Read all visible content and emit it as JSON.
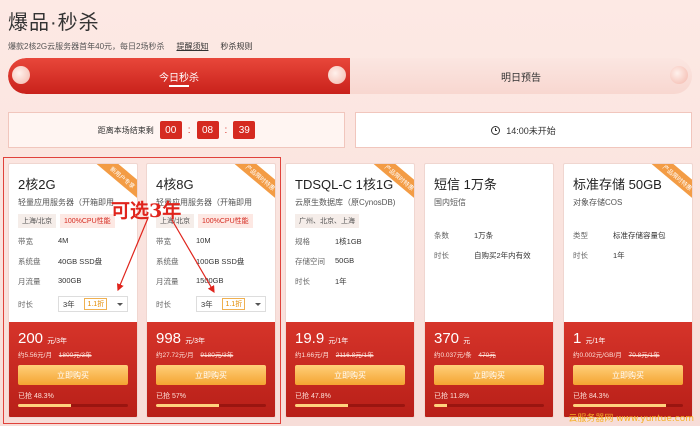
{
  "header": {
    "title": "爆品·秒杀",
    "description": "爆款2核2G云服务器首年40元，每日2场秒杀",
    "link_remind": "提醒须知",
    "link_rules": "秒杀规则"
  },
  "tabs": [
    {
      "label": "今日秒杀",
      "active": true
    },
    {
      "label": "明日预告",
      "active": false
    }
  ],
  "countdown": {
    "label": "距离本场结束剩",
    "hours": "00",
    "minutes": "08",
    "seconds": "39"
  },
  "next_session": {
    "label": "14:00未开始",
    "icon": "clock-icon"
  },
  "annotation": "可选3年",
  "watermark": "云服务器网 www.yuntue.com",
  "cards": [
    {
      "name": "2核2G",
      "desc": "轻量应用服务器（开箱即用",
      "tag_region": "上海/北京",
      "tag_perf": "100%CPU性能",
      "badge": "新用户专享",
      "specs": [
        {
          "label": "带宽",
          "value": "4M"
        },
        {
          "label": "系统盘",
          "value": "40GB SSD盘"
        },
        {
          "label": "月流量",
          "value": "300GB"
        }
      ],
      "term_label": "时长",
      "term_value": "3年",
      "term_discount": "1.1折",
      "price": "200",
      "price_unit": "元/3年",
      "price_sub": "约5.56元/月",
      "price_orig": "1800元/3年",
      "buy_label": "立即购买",
      "sold_label": "已抢 48.3%",
      "sold_pct": 48.3
    },
    {
      "name": "4核8G",
      "desc": "轻量应用服务器（开箱即用",
      "tag_region": "上海/北京",
      "tag_perf": "100%CPU性能",
      "badge": "产品限时特惠",
      "specs": [
        {
          "label": "带宽",
          "value": "10M"
        },
        {
          "label": "系统盘",
          "value": "100GB SSD盘"
        },
        {
          "label": "月流量",
          "value": "1500GB"
        }
      ],
      "term_label": "时长",
      "term_value": "3年",
      "term_discount": "1.1折",
      "price": "998",
      "price_unit": "元/3年",
      "price_sub": "约27.72元/月",
      "price_orig": "9180元/3年",
      "buy_label": "立即购买",
      "sold_label": "已抢 57%",
      "sold_pct": 57
    },
    {
      "name": "TDSQL-C 1核1G",
      "desc": "云原生数据库（原CynosDB)",
      "tag_region": "广州、北京、上海",
      "tag_perf": "",
      "badge": "产品限时特惠",
      "specs": [
        {
          "label": "规格",
          "value": "1核1GB"
        },
        {
          "label": "存储空间",
          "value": "50GB"
        },
        {
          "label": "时长",
          "value": "1年"
        }
      ],
      "price": "19.9",
      "price_unit": "元/1年",
      "price_sub": "约1.66元/月",
      "price_orig": "2116.8元/1年",
      "buy_label": "立即购买",
      "sold_label": "已抢 47.8%",
      "sold_pct": 47.8
    },
    {
      "name": "短信 1万条",
      "desc": "国内短信",
      "tag_region": "",
      "tag_perf": "",
      "badge": "",
      "specs": [
        {
          "label": "条数",
          "value": "1万条"
        },
        {
          "label": "时长",
          "value": "自购买2年内有效"
        }
      ],
      "price": "370",
      "price_unit": "元",
      "price_sub": "约0.037元/条",
      "price_orig": "470元",
      "buy_label": "立即购买",
      "sold_label": "已抢 11.8%",
      "sold_pct": 11.8
    },
    {
      "name": "标准存储 50GB",
      "desc": "对象存储COS",
      "tag_region": "",
      "tag_perf": "",
      "badge": "产品限时特惠",
      "specs": [
        {
          "label": "类型",
          "value": "标准存储容量包"
        },
        {
          "label": "时长",
          "value": "1年"
        }
      ],
      "price": "1",
      "price_unit": "元/1年",
      "price_sub": "约0.002元/GB/月",
      "price_orig": "70.8元/1年",
      "buy_label": "立即购买",
      "sold_label": "已抢 84.3%",
      "sold_pct": 84.3
    }
  ]
}
